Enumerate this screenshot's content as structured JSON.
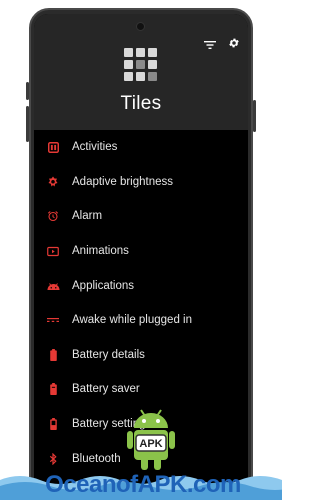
{
  "app": {
    "title": "Tiles"
  },
  "header_actions": [
    {
      "name": "filter-icon"
    },
    {
      "name": "settings-gear-icon"
    }
  ],
  "tiles": [
    {
      "label": "Activities",
      "icon": "activities-icon"
    },
    {
      "label": "Adaptive brightness",
      "icon": "brightness-icon"
    },
    {
      "label": "Alarm",
      "icon": "alarm-icon"
    },
    {
      "label": "Animations",
      "icon": "animations-icon"
    },
    {
      "label": "Applications",
      "icon": "android-icon"
    },
    {
      "label": "Awake while plugged in",
      "icon": "awake-icon"
    },
    {
      "label": "Battery details",
      "icon": "battery-icon"
    },
    {
      "label": "Battery saver",
      "icon": "battery-saver-icon"
    },
    {
      "label": "Battery settings",
      "icon": "battery-settings-icon"
    },
    {
      "label": "Bluetooth",
      "icon": "bluetooth-icon"
    }
  ],
  "watermark": {
    "text": "OceanofAPK.com",
    "badge": "APK"
  },
  "colors": {
    "accent": "#e53935",
    "header_bg": "#262626",
    "list_bg": "#000000",
    "text": "#e6e6e6",
    "watermark": "#1f63b8"
  }
}
